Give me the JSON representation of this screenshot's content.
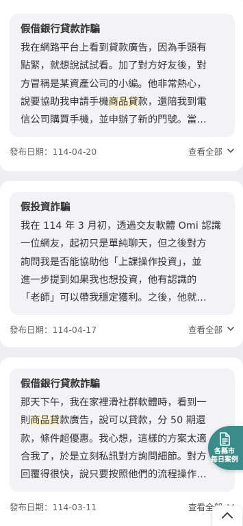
{
  "cases": [
    {
      "title": "假借銀行貸款詐騙",
      "lines": [
        [
          "我在網路平台上看到貸款廣告，因為手頭有"
        ],
        [
          "點緊，就想說試試看。加了對方好友後，對"
        ],
        [
          "方冒稱是某資產公司的小編。他非常熱心，"
        ],
        [
          "說要協助我申請手機",
          {
            "hl": "商品貸"
          },
          "款，還陪我到電"
        ],
        [
          "信公司購買手機，並申辦了新的門號。當…"
        ]
      ],
      "date_label": "發布日期：114-04-20",
      "more_label": "查看全部"
    },
    {
      "title": "假投資詐騙",
      "lines": [
        [
          "我在 114 年 3 月初，透過交友軟體 Omi 認識"
        ],
        [
          "一位網友，起初只是單純聊天，但之後對方"
        ],
        [
          "詢問我是否能協助他「上課操作投資」，並"
        ],
        [
          "進一步提到如果我也想投資，他有認識的"
        ],
        [
          "「老師」可以帶我穩定獲利。之後，他就…"
        ]
      ],
      "date_label": "發布日期：114-04-17",
      "more_label": "查看全部"
    },
    {
      "title": "假借銀行貸款詐騙",
      "lines": [
        [
          "那天下午，我在家裡滑社群軟體時，看到一"
        ],
        [
          "則",
          {
            "hl": "商品貸"
          },
          "款廣告，說可以貸款，分 50 期還"
        ],
        [
          "款，條件超優惠。我心想，這樣的方案太適"
        ],
        [
          "合我了，於是立刻私訊對方詢問細節。對方"
        ],
        [
          "回覆得很快，說只要按照他們的流程操作…"
        ]
      ],
      "date_label": "發布日期：114-03-11",
      "more_label": "查看全部"
    }
  ],
  "fab": {
    "label_line1": "各縣市",
    "label_line2": "每日案例",
    "icon": "document-icon"
  },
  "scroll_top": {
    "icon": "chevron-up-icon"
  },
  "colors": {
    "highlight": "#fff2cc",
    "fab": "#3a8c8a",
    "text": "#333333"
  }
}
